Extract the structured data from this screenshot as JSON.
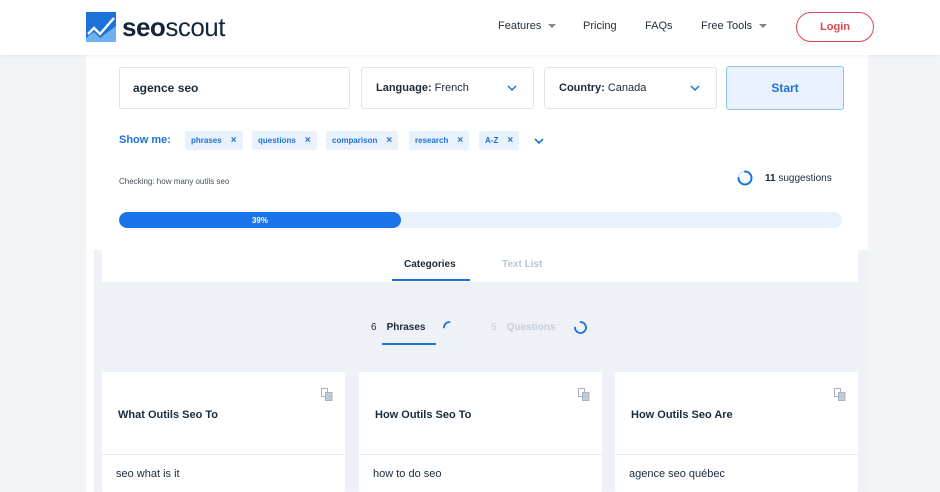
{
  "header": {
    "logo": {
      "bold": "seo",
      "light": "scout"
    },
    "nav": [
      {
        "label": "Features",
        "dropdown": true
      },
      {
        "label": "Pricing",
        "dropdown": false
      },
      {
        "label": "FAQs",
        "dropdown": false
      },
      {
        "label": "Free Tools",
        "dropdown": true
      }
    ],
    "login_label": "Login"
  },
  "search": {
    "query": "agence seo",
    "language_label": "Language:",
    "language_value": "French",
    "country_label": "Country:",
    "country_value": "Canada",
    "start_label": "Start"
  },
  "filters": {
    "label": "Show me:",
    "chips": [
      "phrases",
      "questions",
      "comparison",
      "research",
      "A-Z"
    ],
    "remove_glyph": "×"
  },
  "status": {
    "checking_text": "Checking: how many outils seo",
    "suggestions_count": "11",
    "suggestions_label": "suggestions",
    "progress_label": "39%",
    "progress_percent": 39
  },
  "view_tabs": {
    "items": [
      {
        "label": "Categories",
        "active": true
      },
      {
        "label": "Text List",
        "active": false
      }
    ]
  },
  "sub_tabs": {
    "items": [
      {
        "count": "6",
        "label": "Phrases",
        "active": true
      },
      {
        "count": "5",
        "label": "Questions",
        "active": false
      }
    ]
  },
  "cards": [
    {
      "title": "What Outils Seo To",
      "items": [
        "seo what is it"
      ]
    },
    {
      "title": "How Outils Seo To",
      "items": [
        "how to do seo"
      ]
    },
    {
      "title": "How Outils Seo Are",
      "items": [
        "agence seo québec"
      ]
    }
  ],
  "colors": {
    "accent": "#1d72d8",
    "progress": "#1a73e8",
    "login": "#e0474c",
    "chip_bg": "#e9f2fc"
  },
  "icons": {
    "logo": "seoscout-logo-mark",
    "dropdown": "caret-down-icon",
    "select_chevron": "chevron-down-icon",
    "chip_remove": "close-icon",
    "spinner": "loading-spinner-icon",
    "copy": "copy-icon"
  }
}
